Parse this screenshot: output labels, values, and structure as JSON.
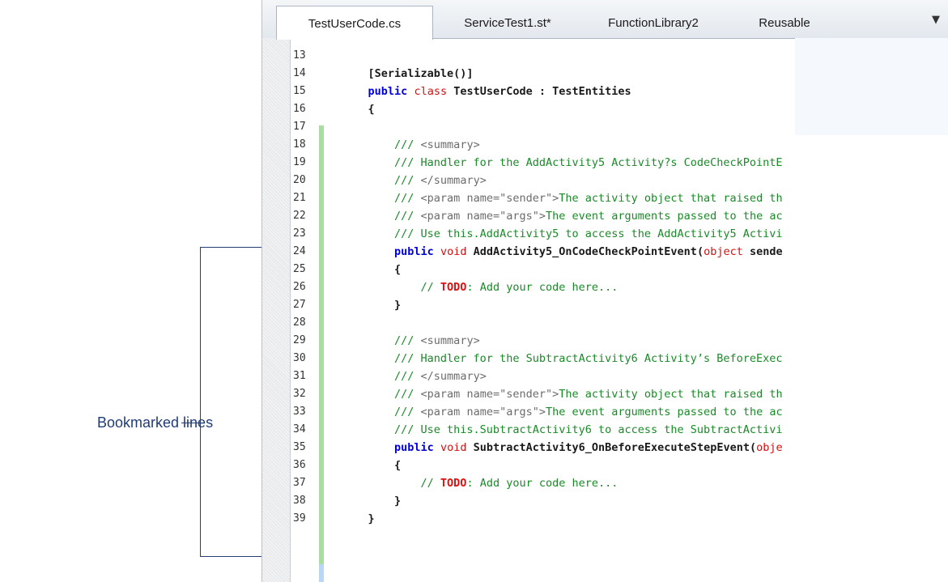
{
  "tabs": [
    {
      "label": "TestUserCode.cs",
      "active": true
    },
    {
      "label": "ServiceTest1.st*",
      "active": false
    },
    {
      "label": "FunctionLibrary2",
      "active": false
    },
    {
      "label": "Reusable",
      "active": false
    }
  ],
  "tab_menu_glyph": "▼",
  "annotation": {
    "label": "Bookmarked lines"
  },
  "bookmarked_lines": [
    26,
    37
  ],
  "colors": {
    "keyword": "#0000dd",
    "keyword_red": "#d21010",
    "comment": "#1a8a28",
    "todo": "#e01010",
    "change_bar": "#a8dfa0",
    "annotation": "#1f3c78"
  },
  "code_lines": [
    {
      "n": "13",
      "tokens": []
    },
    {
      "n": "14",
      "tokens": [
        {
          "t": "    ",
          "c": ""
        },
        {
          "t": "[Serializable()]",
          "c": "bold"
        }
      ]
    },
    {
      "n": "15",
      "tokens": [
        {
          "t": "    ",
          "c": ""
        },
        {
          "t": "public",
          "c": "kw"
        },
        {
          "t": " ",
          "c": ""
        },
        {
          "t": "class",
          "c": "kw-red"
        },
        {
          "t": " TestUserCode : TestEntities",
          "c": "bold"
        }
      ]
    },
    {
      "n": "16",
      "tokens": [
        {
          "t": "    {",
          "c": "bold"
        }
      ]
    },
    {
      "n": "17",
      "tokens": []
    },
    {
      "n": "18",
      "tokens": [
        {
          "t": "        /// ",
          "c": "cmt"
        },
        {
          "t": "<summary>",
          "c": "xml"
        }
      ]
    },
    {
      "n": "19",
      "tokens": [
        {
          "t": "        /// Handler for the AddActivity5 Activity?s CodeCheckPointE",
          "c": "cmt"
        }
      ]
    },
    {
      "n": "20",
      "tokens": [
        {
          "t": "        /// ",
          "c": "cmt"
        },
        {
          "t": "</summary>",
          "c": "xml"
        }
      ]
    },
    {
      "n": "21",
      "tokens": [
        {
          "t": "        /// ",
          "c": "cmt"
        },
        {
          "t": "<param name=\"sender\">",
          "c": "xml"
        },
        {
          "t": "The activity object that raised th",
          "c": "cmt"
        }
      ]
    },
    {
      "n": "22",
      "tokens": [
        {
          "t": "        /// ",
          "c": "cmt"
        },
        {
          "t": "<param name=\"args\">",
          "c": "xml"
        },
        {
          "t": "The event arguments passed to the ac",
          "c": "cmt"
        }
      ]
    },
    {
      "n": "23",
      "tokens": [
        {
          "t": "        /// Use this.AddActivity5 to access the AddActivity5 Activi",
          "c": "cmt"
        }
      ]
    },
    {
      "n": "24",
      "tokens": [
        {
          "t": "        ",
          "c": ""
        },
        {
          "t": "public",
          "c": "kw"
        },
        {
          "t": " ",
          "c": ""
        },
        {
          "t": "void",
          "c": "kw-red"
        },
        {
          "t": " AddActivity5_OnCodeCheckPointEvent(",
          "c": "bold"
        },
        {
          "t": "object",
          "c": "kw-red"
        },
        {
          "t": " sende",
          "c": "bold"
        }
      ]
    },
    {
      "n": "25",
      "tokens": [
        {
          "t": "        {",
          "c": "bold"
        }
      ]
    },
    {
      "n": "26",
      "tokens": [
        {
          "t": "            // ",
          "c": "cmt"
        },
        {
          "t": "TODO",
          "c": "todo"
        },
        {
          "t": ": Add your code here...",
          "c": "cmt"
        }
      ]
    },
    {
      "n": "27",
      "tokens": [
        {
          "t": "        }",
          "c": "bold"
        }
      ]
    },
    {
      "n": "28",
      "tokens": []
    },
    {
      "n": "29",
      "tokens": [
        {
          "t": "        /// ",
          "c": "cmt"
        },
        {
          "t": "<summary>",
          "c": "xml"
        }
      ]
    },
    {
      "n": "30",
      "tokens": [
        {
          "t": "        /// Handler for the SubtractActivity6 Activity’s BeforeExec",
          "c": "cmt"
        }
      ]
    },
    {
      "n": "31",
      "tokens": [
        {
          "t": "        /// ",
          "c": "cmt"
        },
        {
          "t": "</summary>",
          "c": "xml"
        }
      ]
    },
    {
      "n": "32",
      "tokens": [
        {
          "t": "        /// ",
          "c": "cmt"
        },
        {
          "t": "<param name=\"sender\">",
          "c": "xml"
        },
        {
          "t": "The activity object that raised th",
          "c": "cmt"
        }
      ]
    },
    {
      "n": "33",
      "tokens": [
        {
          "t": "        /// ",
          "c": "cmt"
        },
        {
          "t": "<param name=\"args\">",
          "c": "xml"
        },
        {
          "t": "The event arguments passed to the ac",
          "c": "cmt"
        }
      ]
    },
    {
      "n": "34",
      "tokens": [
        {
          "t": "        /// Use this.SubtractActivity6 to access the SubtractActivi",
          "c": "cmt"
        }
      ]
    },
    {
      "n": "35",
      "tokens": [
        {
          "t": "        ",
          "c": ""
        },
        {
          "t": "public",
          "c": "kw"
        },
        {
          "t": " ",
          "c": ""
        },
        {
          "t": "void",
          "c": "kw-red"
        },
        {
          "t": " SubtractActivity6_OnBeforeExecuteStepEvent(",
          "c": "bold"
        },
        {
          "t": "obje",
          "c": "kw-red"
        }
      ]
    },
    {
      "n": "36",
      "tokens": [
        {
          "t": "        {",
          "c": "bold"
        }
      ]
    },
    {
      "n": "37",
      "tokens": [
        {
          "t": "            // ",
          "c": "cmt"
        },
        {
          "t": "TODO",
          "c": "todo"
        },
        {
          "t": ": Add your code here...",
          "c": "cmt"
        }
      ]
    },
    {
      "n": "38",
      "tokens": [
        {
          "t": "        }",
          "c": "bold"
        }
      ]
    },
    {
      "n": "39",
      "tokens": [
        {
          "t": "    }",
          "c": "bold"
        }
      ]
    }
  ]
}
